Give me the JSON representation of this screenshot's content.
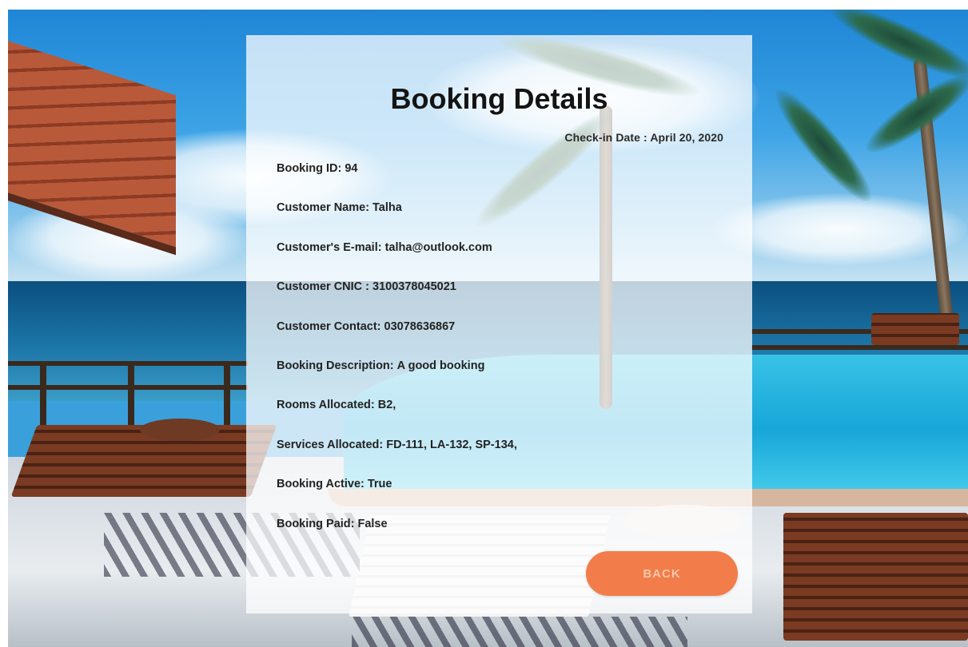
{
  "card": {
    "title": "Booking Details",
    "checkin_label": "Check-in Date :",
    "checkin_value": "April 20, 2020",
    "fields": [
      {
        "label": "Booking ID:",
        "value": "94"
      },
      {
        "label": "Customer Name:",
        "value": "Talha"
      },
      {
        "label": "Customer's E-mail:",
        "value": "talha@outlook.com"
      },
      {
        "label": "Customer CNIC :",
        "value": "3100378045021"
      },
      {
        "label": "Customer Contact:",
        "value": "03078636867"
      },
      {
        "label": "Booking Description:",
        "value": "A good booking"
      },
      {
        "label": "Rooms Allocated:",
        "value": "B2,"
      },
      {
        "label": "Services Allocated:",
        "value": "FD-111, LA-132, SP-134,"
      },
      {
        "label": "Booking Active:",
        "value": "True"
      },
      {
        "label": "Booking Paid:",
        "value": "False"
      }
    ],
    "back_label": "BACK"
  },
  "colors": {
    "accent": "#f27d4a",
    "card_background": "rgba(255,255,255,0.74)"
  }
}
